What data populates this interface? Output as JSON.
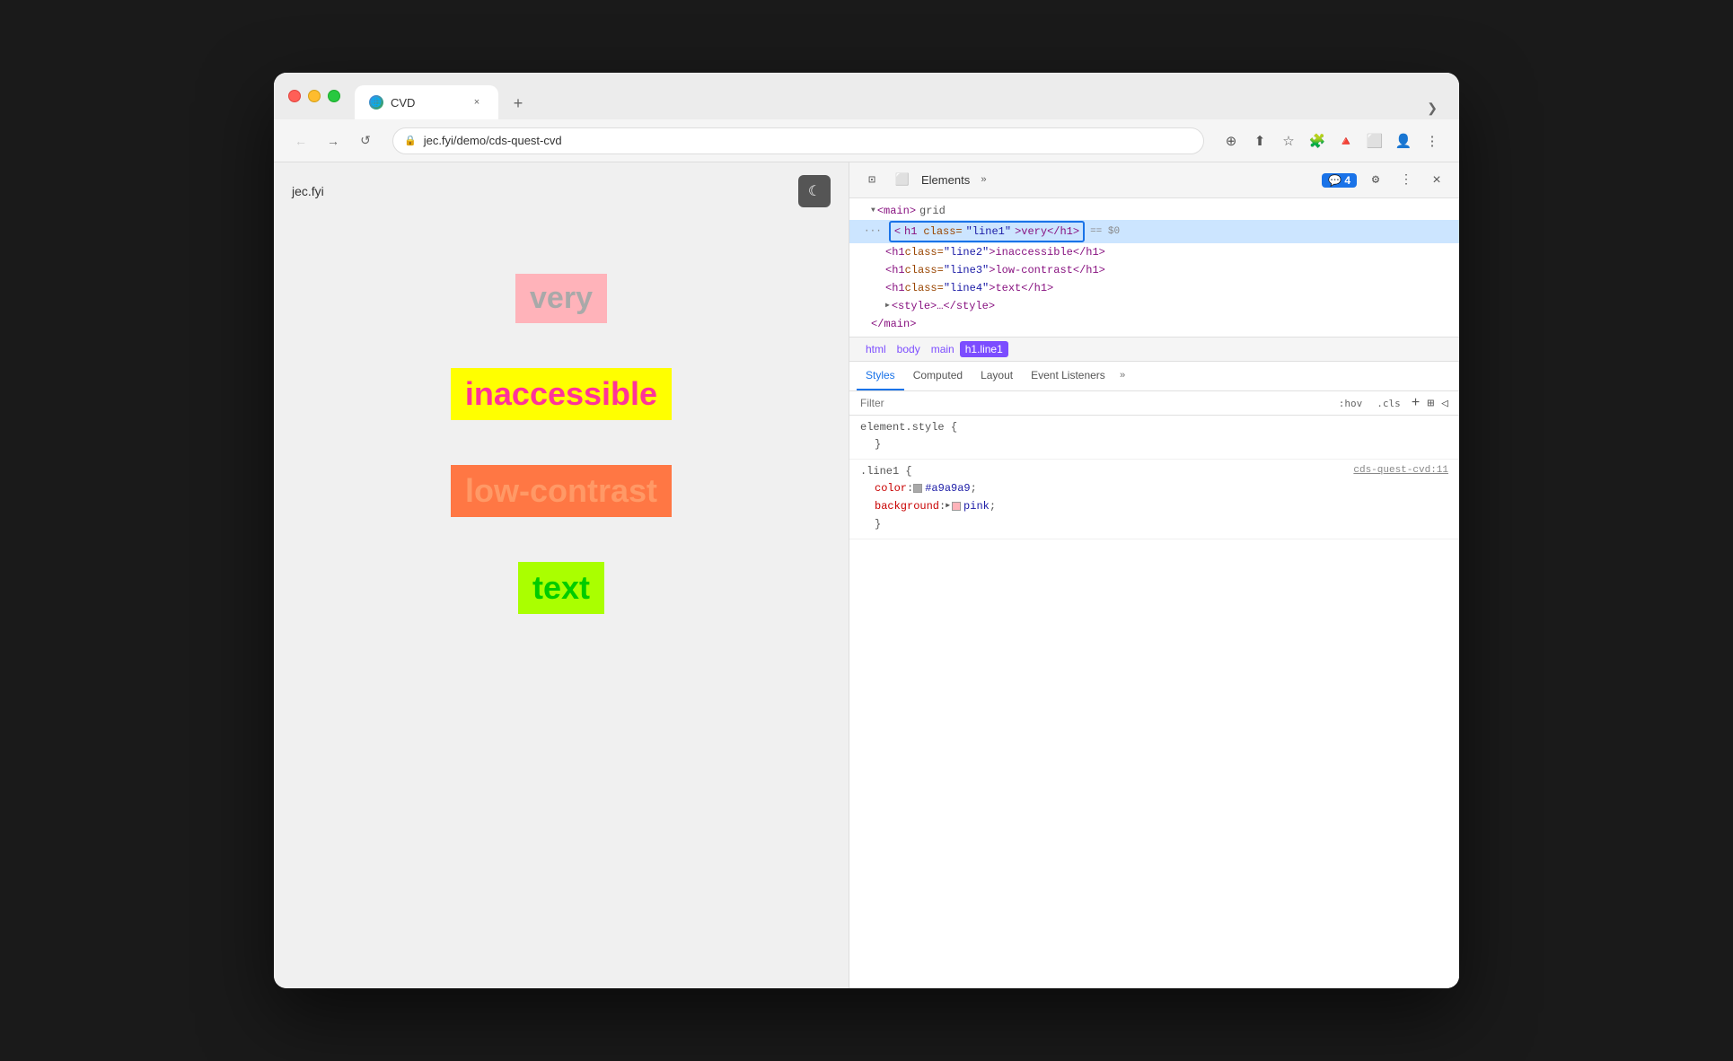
{
  "browser": {
    "traffic_lights": [
      "red",
      "yellow",
      "green"
    ],
    "tab": {
      "favicon": "🌐",
      "title": "CVD",
      "close_label": "×"
    },
    "new_tab_label": "+",
    "tab_more_label": "❯",
    "nav": {
      "back_label": "←",
      "forward_label": "→",
      "reload_label": "↺",
      "url": "jec.fyi/demo/cds-quest-cvd",
      "lock_label": "🔒"
    },
    "toolbar_icons": {
      "search": "⊕",
      "share": "⬆",
      "bookmark": "☆",
      "extensions": "🧩",
      "profile": "👤",
      "more": "⋮"
    }
  },
  "page": {
    "site_title": "jec.fyi",
    "dark_mode_icon": "☾",
    "words": [
      {
        "text": "very",
        "class": "word-very"
      },
      {
        "text": "inaccessible",
        "class": "word-inaccessible"
      },
      {
        "text": "low-contrast",
        "class": "word-low-contrast"
      },
      {
        "text": "text",
        "class": "word-text"
      }
    ]
  },
  "devtools": {
    "toolbar": {
      "inspect_icon": "⊡",
      "device_icon": "⬜",
      "elements_label": "Elements",
      "more_label": "»",
      "badge": "4",
      "settings_icon": "⚙",
      "more_dots": "⋮",
      "close_icon": "×"
    },
    "tree": {
      "parent_line": "<main> grid",
      "selected_line": "<h1 class=\"line1\">very</h1>",
      "dollar_zero": "== $0",
      "lines": [
        {
          "indent": 2,
          "html": "<h1 class=\"line2\">inaccessible</h1>"
        },
        {
          "indent": 2,
          "html": "<h1 class=\"line3\">low-contrast</h1>"
        },
        {
          "indent": 2,
          "html": "<h1 class=\"line4\">text</h1>"
        },
        {
          "indent": 2,
          "html": "<style>…</style>"
        },
        {
          "indent": 1,
          "html": "</main>"
        }
      ],
      "dots_label": "···"
    },
    "breadcrumbs": [
      "html",
      "body",
      "main",
      "h1.line1"
    ],
    "panels": {
      "tabs": [
        "Styles",
        "Computed",
        "Layout",
        "Event Listeners",
        "»"
      ],
      "active_tab": "Styles"
    },
    "filter": {
      "placeholder": "Filter",
      "hov_label": ":hov",
      "cls_label": ".cls",
      "plus_label": "+",
      "grid_icon": "⊞",
      "arrow_icon": "◁"
    },
    "styles": [
      {
        "selector": "element.style {",
        "close": "}",
        "link": "",
        "properties": []
      },
      {
        "selector": ".line1 {",
        "close": "}",
        "link": "cds-quest-cvd:11",
        "properties": [
          {
            "prop": "color",
            "colon": ":",
            "value": "#a9a9a9",
            "swatch": "#a9a9a9",
            "semicolon": ";"
          },
          {
            "prop": "background",
            "colon": ":",
            "value": "pink",
            "swatch": "#ffb3ba",
            "semicolon": ";"
          }
        ]
      }
    ]
  }
}
